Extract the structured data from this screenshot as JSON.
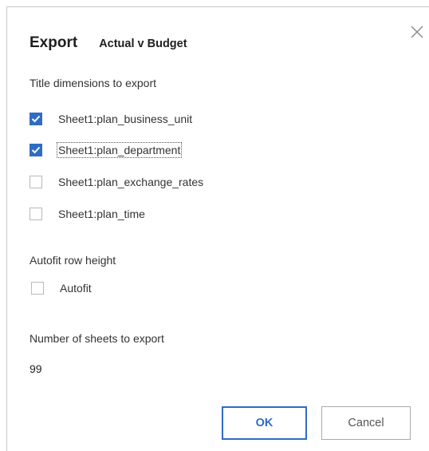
{
  "dialog": {
    "title": "Export",
    "subtitle": "Actual v Budget",
    "close_icon": "close-icon"
  },
  "title_dimensions": {
    "label": "Title dimensions to export",
    "items": [
      {
        "label": "Sheet1:plan_business_unit",
        "checked": true
      },
      {
        "label": "Sheet1:plan_department",
        "checked": true,
        "focused": true
      },
      {
        "label": "Sheet1:plan_exchange_rates",
        "checked": false
      },
      {
        "label": "Sheet1:plan_time",
        "checked": false
      }
    ]
  },
  "autofit": {
    "label": "Autofit row height",
    "option_label": "Autofit",
    "checked": false
  },
  "sheets": {
    "label": "Number of sheets to export",
    "value": "99"
  },
  "buttons": {
    "ok_label": "OK",
    "cancel_label": "Cancel"
  },
  "colors": {
    "accent": "#2f6cc4",
    "border": "#b9b9b9"
  }
}
